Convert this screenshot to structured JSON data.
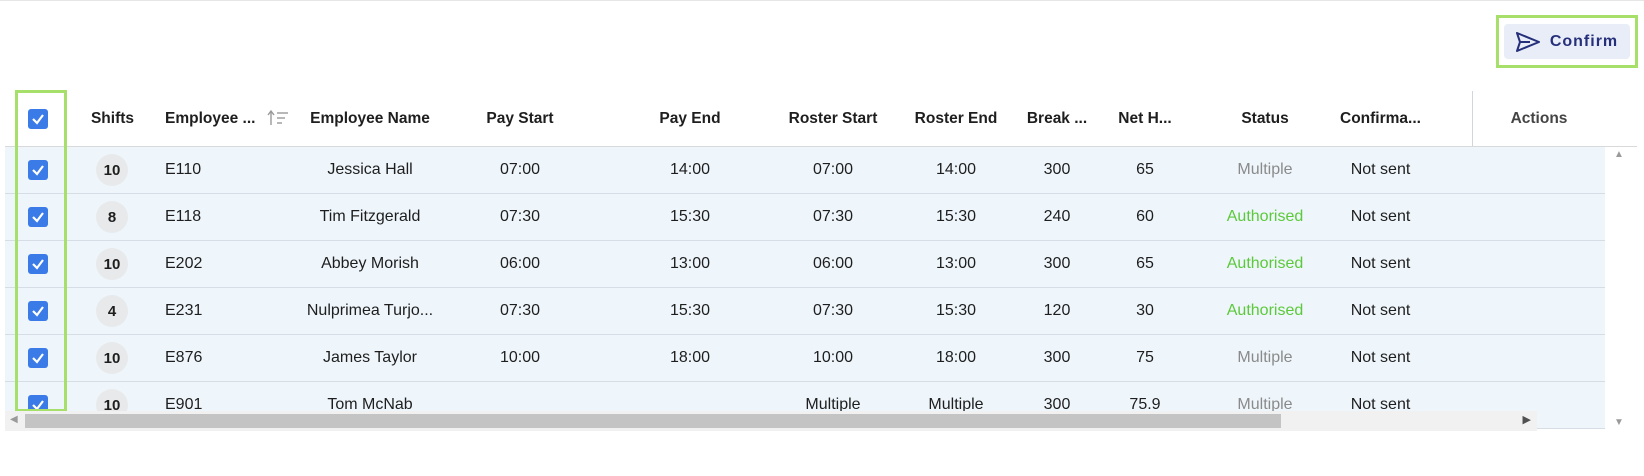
{
  "toolbar": {
    "confirm_label": "Confirm",
    "confirm_icon": "send-icon"
  },
  "columns": {
    "shifts": "Shifts",
    "employee_id": "Employee ...",
    "employee_name": "Employee Name",
    "pay_start": "Pay Start",
    "pay_end": "Pay End",
    "roster_start": "Roster Start",
    "roster_end": "Roster End",
    "break": "Break ...",
    "net_hours": "Net H...",
    "status": "Status",
    "confirmation": "Confirma...",
    "actions": "Actions"
  },
  "rows": [
    {
      "selected": true,
      "shifts": "10",
      "employee_id": "E110",
      "employee_name": "Jessica Hall",
      "pay_start": "07:00",
      "pay_end": "14:00",
      "roster_start": "07:00",
      "roster_end": "14:00",
      "break": "300",
      "net_hours": "65",
      "status": "Multiple",
      "confirmation": "Not sent"
    },
    {
      "selected": true,
      "shifts": "8",
      "employee_id": "E118",
      "employee_name": "Tim Fitzgerald",
      "pay_start": "07:30",
      "pay_end": "15:30",
      "roster_start": "07:30",
      "roster_end": "15:30",
      "break": "240",
      "net_hours": "60",
      "status": "Authorised",
      "confirmation": "Not sent"
    },
    {
      "selected": true,
      "shifts": "10",
      "employee_id": "E202",
      "employee_name": "Abbey Morish",
      "pay_start": "06:00",
      "pay_end": "13:00",
      "roster_start": "06:00",
      "roster_end": "13:00",
      "break": "300",
      "net_hours": "65",
      "status": "Authorised",
      "confirmation": "Not sent"
    },
    {
      "selected": true,
      "shifts": "4",
      "employee_id": "E231",
      "employee_name": "Nulprimea Turjo...",
      "pay_start": "07:30",
      "pay_end": "15:30",
      "roster_start": "07:30",
      "roster_end": "15:30",
      "break": "120",
      "net_hours": "30",
      "status": "Authorised",
      "confirmation": "Not sent"
    },
    {
      "selected": true,
      "shifts": "10",
      "employee_id": "E876",
      "employee_name": "James Taylor",
      "pay_start": "10:00",
      "pay_end": "18:00",
      "roster_start": "10:00",
      "roster_end": "18:00",
      "break": "300",
      "net_hours": "75",
      "status": "Multiple",
      "confirmation": "Not sent"
    },
    {
      "selected": true,
      "shifts": "10",
      "employee_id": "E901",
      "employee_name": "Tom McNab",
      "pay_start": "",
      "pay_end": "",
      "roster_start": "Multiple",
      "roster_end": "Multiple",
      "break": "300",
      "net_hours": "75.9",
      "status": "Multiple",
      "confirmation": "Not sent"
    }
  ],
  "colors": {
    "accent": "#3b7be8",
    "authorised": "#5cc93a",
    "multiple": "#8a8a8a",
    "highlight": "#a6e06a"
  }
}
